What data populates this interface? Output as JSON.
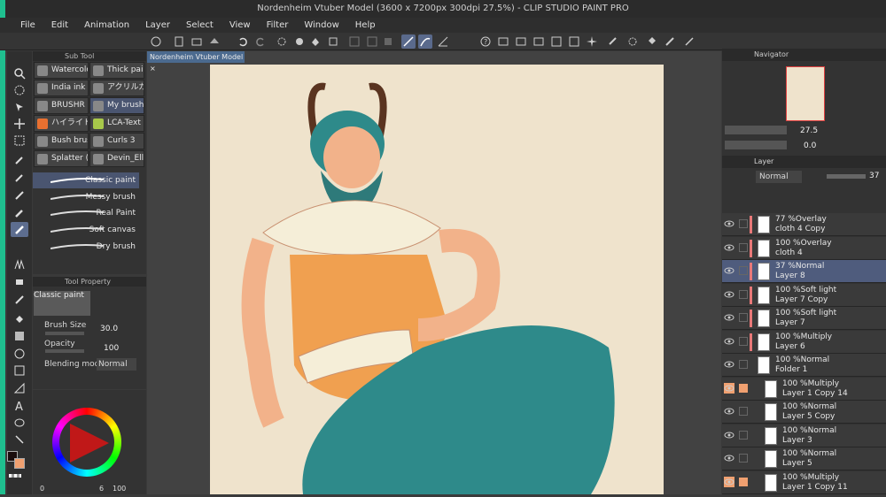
{
  "window": {
    "title": "Nordenheim Vtuber Model (3600 x 7200px 300dpi 27.5%)  - CLIP STUDIO PAINT PRO"
  },
  "menu": [
    "File",
    "Edit",
    "Animation",
    "Layer",
    "Select",
    "View",
    "Filter",
    "Window",
    "Help"
  ],
  "subtool": {
    "header": "Sub Tool",
    "brushes": [
      {
        "label": "Watercolo",
        "icon": "watercolor-icon"
      },
      {
        "label": "Thick pain",
        "icon": "thick-paint-icon"
      },
      {
        "label": "India ink",
        "icon": "ink-icon"
      },
      {
        "label": "アクリルガッ",
        "icon": "acrylic-icon"
      },
      {
        "label": "BRUSHR",
        "icon": "brush-icon"
      },
      {
        "label": "My brushe",
        "icon": "my-brush-icon"
      },
      {
        "label": "ハイライト",
        "icon": "highlight-icon"
      },
      {
        "label": "LCA-Text",
        "icon": "texture-icon"
      },
      {
        "label": "Bush brus",
        "icon": "bush-icon"
      },
      {
        "label": "Curls 3",
        "icon": "curls-icon"
      },
      {
        "label": "Splatter (F",
        "icon": "splatter-icon"
      },
      {
        "label": "Devin_Elli",
        "icon": "devin-icon"
      }
    ],
    "list": [
      "Classic paint",
      "Messy brush",
      "Real Paint",
      "Soft canvas",
      "Dry brush"
    ]
  },
  "toolprop": {
    "header": "Tool Property",
    "brush_name": "Classic paint",
    "brush_size_label": "Brush Size",
    "brush_size": "30.0",
    "opacity_label": "Opacity",
    "opacity": "100",
    "blend_label": "Blending mode",
    "blend": "Normal"
  },
  "color": {
    "main": "#1a0d0d",
    "sub": "#f0a070",
    "bottom_values": [
      "0",
      "6",
      "100"
    ]
  },
  "doc_tab": "Nordenheim Vtuber Model",
  "navigator": {
    "header": "Navigator",
    "zoom": "27.5",
    "rotation": "0.0"
  },
  "layer_panel": {
    "header": "Layer",
    "blend": "Normal",
    "opacity": "37",
    "layers": [
      {
        "line1": "77 %Overlay",
        "line2": "cloth 4 Copy",
        "sel": false,
        "hl": false
      },
      {
        "line1": "100 %Overlay",
        "line2": "cloth 4",
        "sel": false,
        "hl": false
      },
      {
        "line1": "37 %Normal",
        "line2": "Layer 8",
        "sel": true,
        "hl": false
      },
      {
        "line1": "100 %Soft light",
        "line2": "Layer 7 Copy",
        "sel": false,
        "hl": false
      },
      {
        "line1": "100 %Soft light",
        "line2": "Layer 7",
        "sel": false,
        "hl": false
      },
      {
        "line1": "100 %Multiply",
        "line2": "Layer 6",
        "sel": false,
        "hl": false
      },
      {
        "line1": "100 %Normal",
        "line2": "Folder 1",
        "sel": false,
        "hl": false
      },
      {
        "line1": "100 %Multiply",
        "line2": "Layer 1 Copy 14",
        "sel": false,
        "hl": true
      },
      {
        "line1": "100 %Normal",
        "line2": "Layer 5 Copy",
        "sel": false,
        "hl": false
      },
      {
        "line1": "100 %Normal",
        "line2": "Layer 3",
        "sel": false,
        "hl": false
      },
      {
        "line1": "100 %Normal",
        "line2": "Layer 5",
        "sel": false,
        "hl": false
      },
      {
        "line1": "100 %Multiply",
        "line2": "Layer 1 Copy 11",
        "sel": false,
        "hl": true
      }
    ]
  }
}
